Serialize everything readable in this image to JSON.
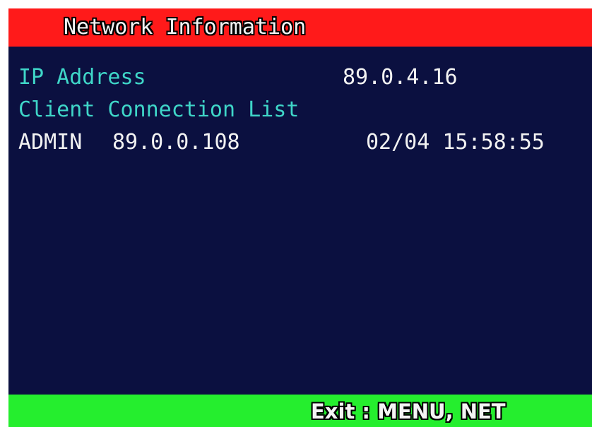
{
  "header": {
    "title": "Network Information"
  },
  "network": {
    "ip_label": "IP Address",
    "ip_value": "89.0.4.16",
    "client_list_label": "Client Connection List",
    "clients": [
      {
        "user": "ADMIN",
        "ip": "89.0.0.108",
        "timestamp": "02/04 15:58:55"
      }
    ]
  },
  "footer": {
    "hint": "Exit : MENU, NET"
  },
  "colors": {
    "title_bar": "#ff1a1a",
    "background": "#0b1040",
    "label_text": "#3fd6c8",
    "value_text": "#f2f2f2",
    "footer_bar": "#25ee2e"
  }
}
